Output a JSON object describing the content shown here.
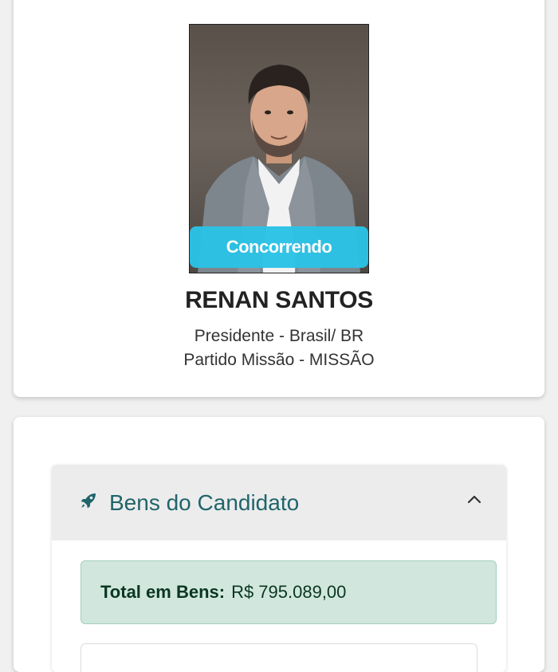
{
  "candidate": {
    "status": "Concorrendo",
    "name": "RENAN SANTOS",
    "office_line": "Presidente - Brasil/ BR",
    "party_line": "Partido Missão - MISSÃO"
  },
  "assets_section": {
    "title": "Bens do Candidato",
    "icon": "rocket-icon",
    "expanded": true,
    "total_label": "Total em Bens:",
    "total_value": "R$ 795.089,00"
  },
  "colors": {
    "status_badge": "#2bc3e6",
    "section_title": "#20656b",
    "total_bg": "#d1e7dd"
  }
}
